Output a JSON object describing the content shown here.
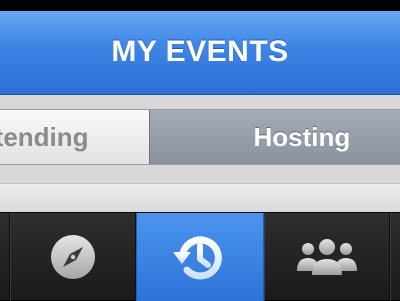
{
  "header": {
    "title": "MY EVENTS"
  },
  "segments": {
    "attending_label": "ttending",
    "hosting_label": "Hosting"
  },
  "tabbar": {
    "items": [
      {
        "name": "explore",
        "icon": "compass-icon",
        "selected": false
      },
      {
        "name": "history",
        "icon": "history-icon",
        "selected": true
      },
      {
        "name": "people",
        "icon": "people-icon",
        "selected": false
      }
    ]
  },
  "colors": {
    "header_blue": "#3f86e6",
    "selected_tab_blue": "#3a84e4",
    "tabbar_dark": "#262626",
    "hosting_gray": "#959ca8"
  }
}
